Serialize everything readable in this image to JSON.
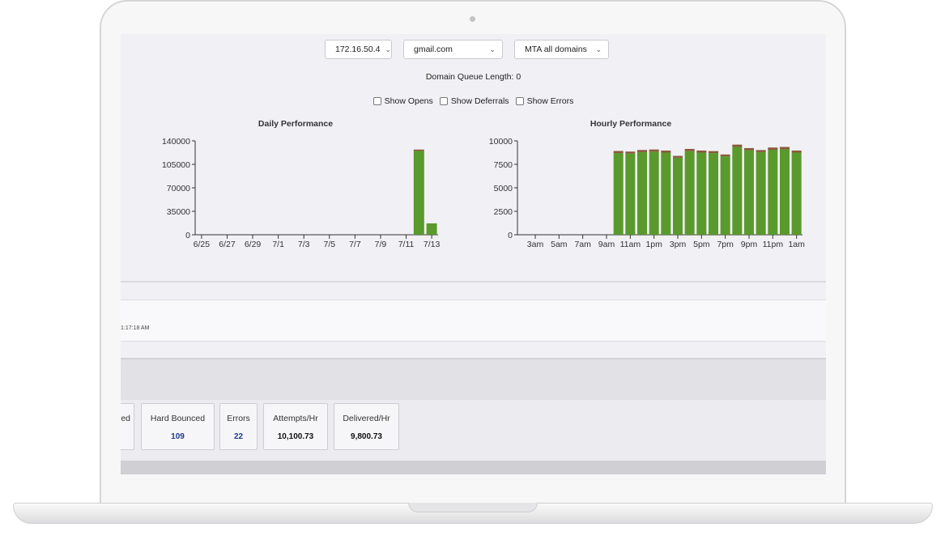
{
  "filters": {
    "ip": "172.16.50.4",
    "domain": "gmail.com",
    "mta": "MTA all domains"
  },
  "queue_text": "Domain Queue Length: 0",
  "toggles": [
    {
      "label": "Show Opens",
      "checked": false
    },
    {
      "label": "Show Deferrals",
      "checked": false
    },
    {
      "label": "Show Errors",
      "checked": false
    }
  ],
  "timestamp_fragment": "1:17:18 AM",
  "stats": {
    "partial_label": "ed",
    "hard_bounced": {
      "label": "Hard Bounced",
      "value": "109"
    },
    "errors": {
      "label": "Errors",
      "value": "22"
    },
    "attempts_hr": {
      "label": "Attempts/Hr",
      "value": "10,100.73"
    },
    "delivered_hr": {
      "label": "Delivered/Hr",
      "value": "9,800.73"
    }
  },
  "colors": {
    "bar_fill": "#5a9a2c",
    "bar_cap": "#8a5a3c",
    "axis": "#333333"
  },
  "chart_data": [
    {
      "type": "bar",
      "title": "Daily Performance",
      "categories": [
        "6/25",
        "6/26",
        "6/27",
        "6/28",
        "6/29",
        "6/30",
        "7/1",
        "7/2",
        "7/3",
        "7/4",
        "7/5",
        "7/6",
        "7/7",
        "7/8",
        "7/9",
        "7/10",
        "7/11",
        "7/12",
        "7/13"
      ],
      "tick_labels": [
        "6/25",
        "6/27",
        "6/29",
        "7/1",
        "7/3",
        "7/5",
        "7/7",
        "7/9",
        "7/11",
        "7/13"
      ],
      "series": [
        {
          "values": [
            0,
            0,
            0,
            0,
            0,
            0,
            0,
            0,
            0,
            0,
            0,
            0,
            0,
            0,
            0,
            0,
            0,
            125000,
            17000
          ]
        },
        {
          "values": [
            0,
            0,
            0,
            0,
            0,
            0,
            0,
            0,
            0,
            0,
            0,
            0,
            0,
            0,
            0,
            0,
            0,
            2000,
            0
          ]
        }
      ],
      "yticks": [
        0,
        35000,
        70000,
        105000,
        140000
      ],
      "ylim": [
        0,
        140000
      ],
      "stacked": true
    },
    {
      "type": "bar",
      "title": "Hourly Performance",
      "categories": [
        "2am",
        "3am",
        "4am",
        "5am",
        "6am",
        "7am",
        "8am",
        "9am",
        "10am",
        "11am",
        "12pm",
        "1pm",
        "2pm",
        "3pm",
        "4pm",
        "5pm",
        "6pm",
        "7pm",
        "8pm",
        "9pm",
        "10pm",
        "11pm",
        "12am",
        "1am"
      ],
      "tick_labels": [
        "3am",
        "5am",
        "7am",
        "9am",
        "11am",
        "1pm",
        "3pm",
        "5pm",
        "7pm",
        "9pm",
        "11pm",
        "1am"
      ],
      "series": [
        {
          "values": [
            0,
            0,
            0,
            0,
            0,
            0,
            0,
            0,
            8700,
            8650,
            8800,
            8850,
            8750,
            8200,
            8900,
            8750,
            8700,
            8350,
            9350,
            9000,
            8800,
            9050,
            9100,
            8750
          ]
        },
        {
          "values": [
            0,
            0,
            0,
            0,
            0,
            0,
            0,
            0,
            220,
            210,
            230,
            230,
            220,
            200,
            240,
            220,
            210,
            200,
            250,
            230,
            220,
            240,
            250,
            220
          ]
        }
      ],
      "yticks": [
        0,
        2500,
        5000,
        7500,
        10000
      ],
      "ylim": [
        0,
        10000
      ],
      "stacked": true
    }
  ]
}
